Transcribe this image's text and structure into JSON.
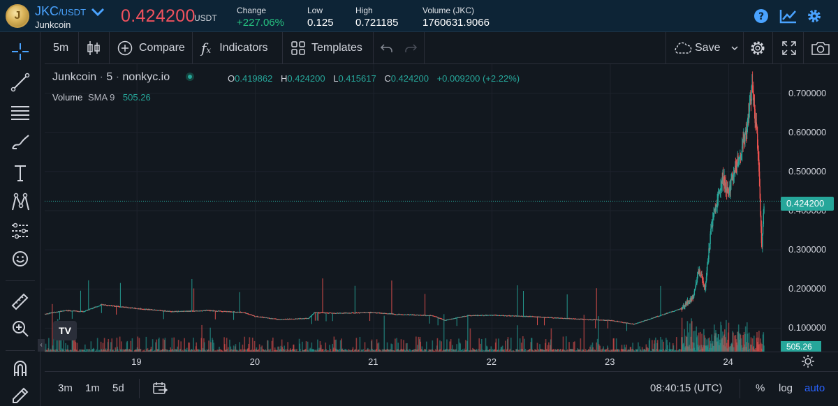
{
  "ticker": {
    "base": "JKC",
    "quote": "/USDT",
    "name": "Junkcoin",
    "last_price": "0.424200",
    "last_price_unit": "USDT",
    "change_label": "Change",
    "change_value": "+227.06%",
    "low_label": "Low",
    "low_value": "0.125",
    "high_label": "High",
    "high_value": "0.721185",
    "volume_label": "Volume (JKC)",
    "volume_value": "1760631.9066",
    "icons": [
      "help-icon",
      "chart-icon",
      "settings-icon"
    ]
  },
  "toolbar": {
    "interval": "5m",
    "compare_label": "Compare",
    "indicators_label": "Indicators",
    "templates_label": "Templates",
    "save_label": "Save"
  },
  "legend": {
    "symbol": "Junkcoin",
    "interval": "5",
    "exchange": "nonkyc.io",
    "o_label": "O",
    "o_value": "0.419862",
    "h_label": "H",
    "h_value": "0.424200",
    "l_label": "L",
    "l_value": "0.415617",
    "c_label": "C",
    "c_value": "0.424200",
    "change": "+0.009200 (+2.22%)",
    "volume_label": "Volume",
    "volume_sma": "SMA 9",
    "volume_value": "505.26"
  },
  "price_axis": {
    "labels": [
      "0.700000",
      "0.600000",
      "0.500000",
      "0.400000",
      "0.300000",
      "0.200000",
      "0.100000"
    ],
    "last_tag": "0.424200",
    "volume_tag": "505.26"
  },
  "time_axis": {
    "labels": [
      "19",
      "20",
      "21",
      "22",
      "23",
      "24"
    ]
  },
  "bottom": {
    "ranges": [
      "3m",
      "1m",
      "5d"
    ],
    "clock": "08:40:15 (UTC)",
    "percent_label": "%",
    "log_label": "log",
    "auto_label": "auto"
  },
  "colors": {
    "up": "#26a69a",
    "down": "#ef5350",
    "accent": "#4aa3ff",
    "price_negative": "#f0525e"
  },
  "chart_data": {
    "type": "candlestick",
    "symbol": "Junkcoin",
    "interval": "5",
    "ylim": [
      0.04,
      0.76
    ],
    "y_ticks": [
      0.1,
      0.2,
      0.3,
      0.4,
      0.5,
      0.6,
      0.7
    ],
    "x_ticks": [
      "19",
      "20",
      "21",
      "22",
      "23",
      "24"
    ],
    "last_price": 0.4242,
    "grid": true,
    "price_path": [
      [
        18.2,
        0.135
      ],
      [
        18.4,
        0.145
      ],
      [
        18.55,
        0.142
      ],
      [
        18.7,
        0.16
      ],
      [
        19.0,
        0.15
      ],
      [
        19.3,
        0.142
      ],
      [
        19.6,
        0.145
      ],
      [
        19.9,
        0.14
      ],
      [
        20.0,
        0.13
      ],
      [
        20.2,
        0.122
      ],
      [
        20.45,
        0.125
      ],
      [
        20.5,
        0.14
      ],
      [
        20.7,
        0.138
      ],
      [
        21.0,
        0.14
      ],
      [
        21.2,
        0.135
      ],
      [
        21.5,
        0.132
      ],
      [
        21.6,
        0.12
      ],
      [
        21.8,
        0.132
      ],
      [
        22.0,
        0.133
      ],
      [
        22.3,
        0.13
      ],
      [
        22.6,
        0.125
      ],
      [
        22.8,
        0.122
      ],
      [
        23.0,
        0.12
      ],
      [
        23.2,
        0.11
      ],
      [
        23.4,
        0.13
      ],
      [
        23.6,
        0.15
      ],
      [
        23.7,
        0.18
      ],
      [
        23.75,
        0.25
      ],
      [
        23.8,
        0.2
      ],
      [
        23.85,
        0.35
      ],
      [
        23.9,
        0.42
      ],
      [
        23.95,
        0.48
      ],
      [
        24.0,
        0.45
      ],
      [
        24.05,
        0.5
      ],
      [
        24.1,
        0.55
      ],
      [
        24.15,
        0.6
      ],
      [
        24.2,
        0.72
      ],
      [
        24.25,
        0.55
      ],
      [
        24.28,
        0.3
      ],
      [
        24.3,
        0.4242
      ]
    ]
  }
}
